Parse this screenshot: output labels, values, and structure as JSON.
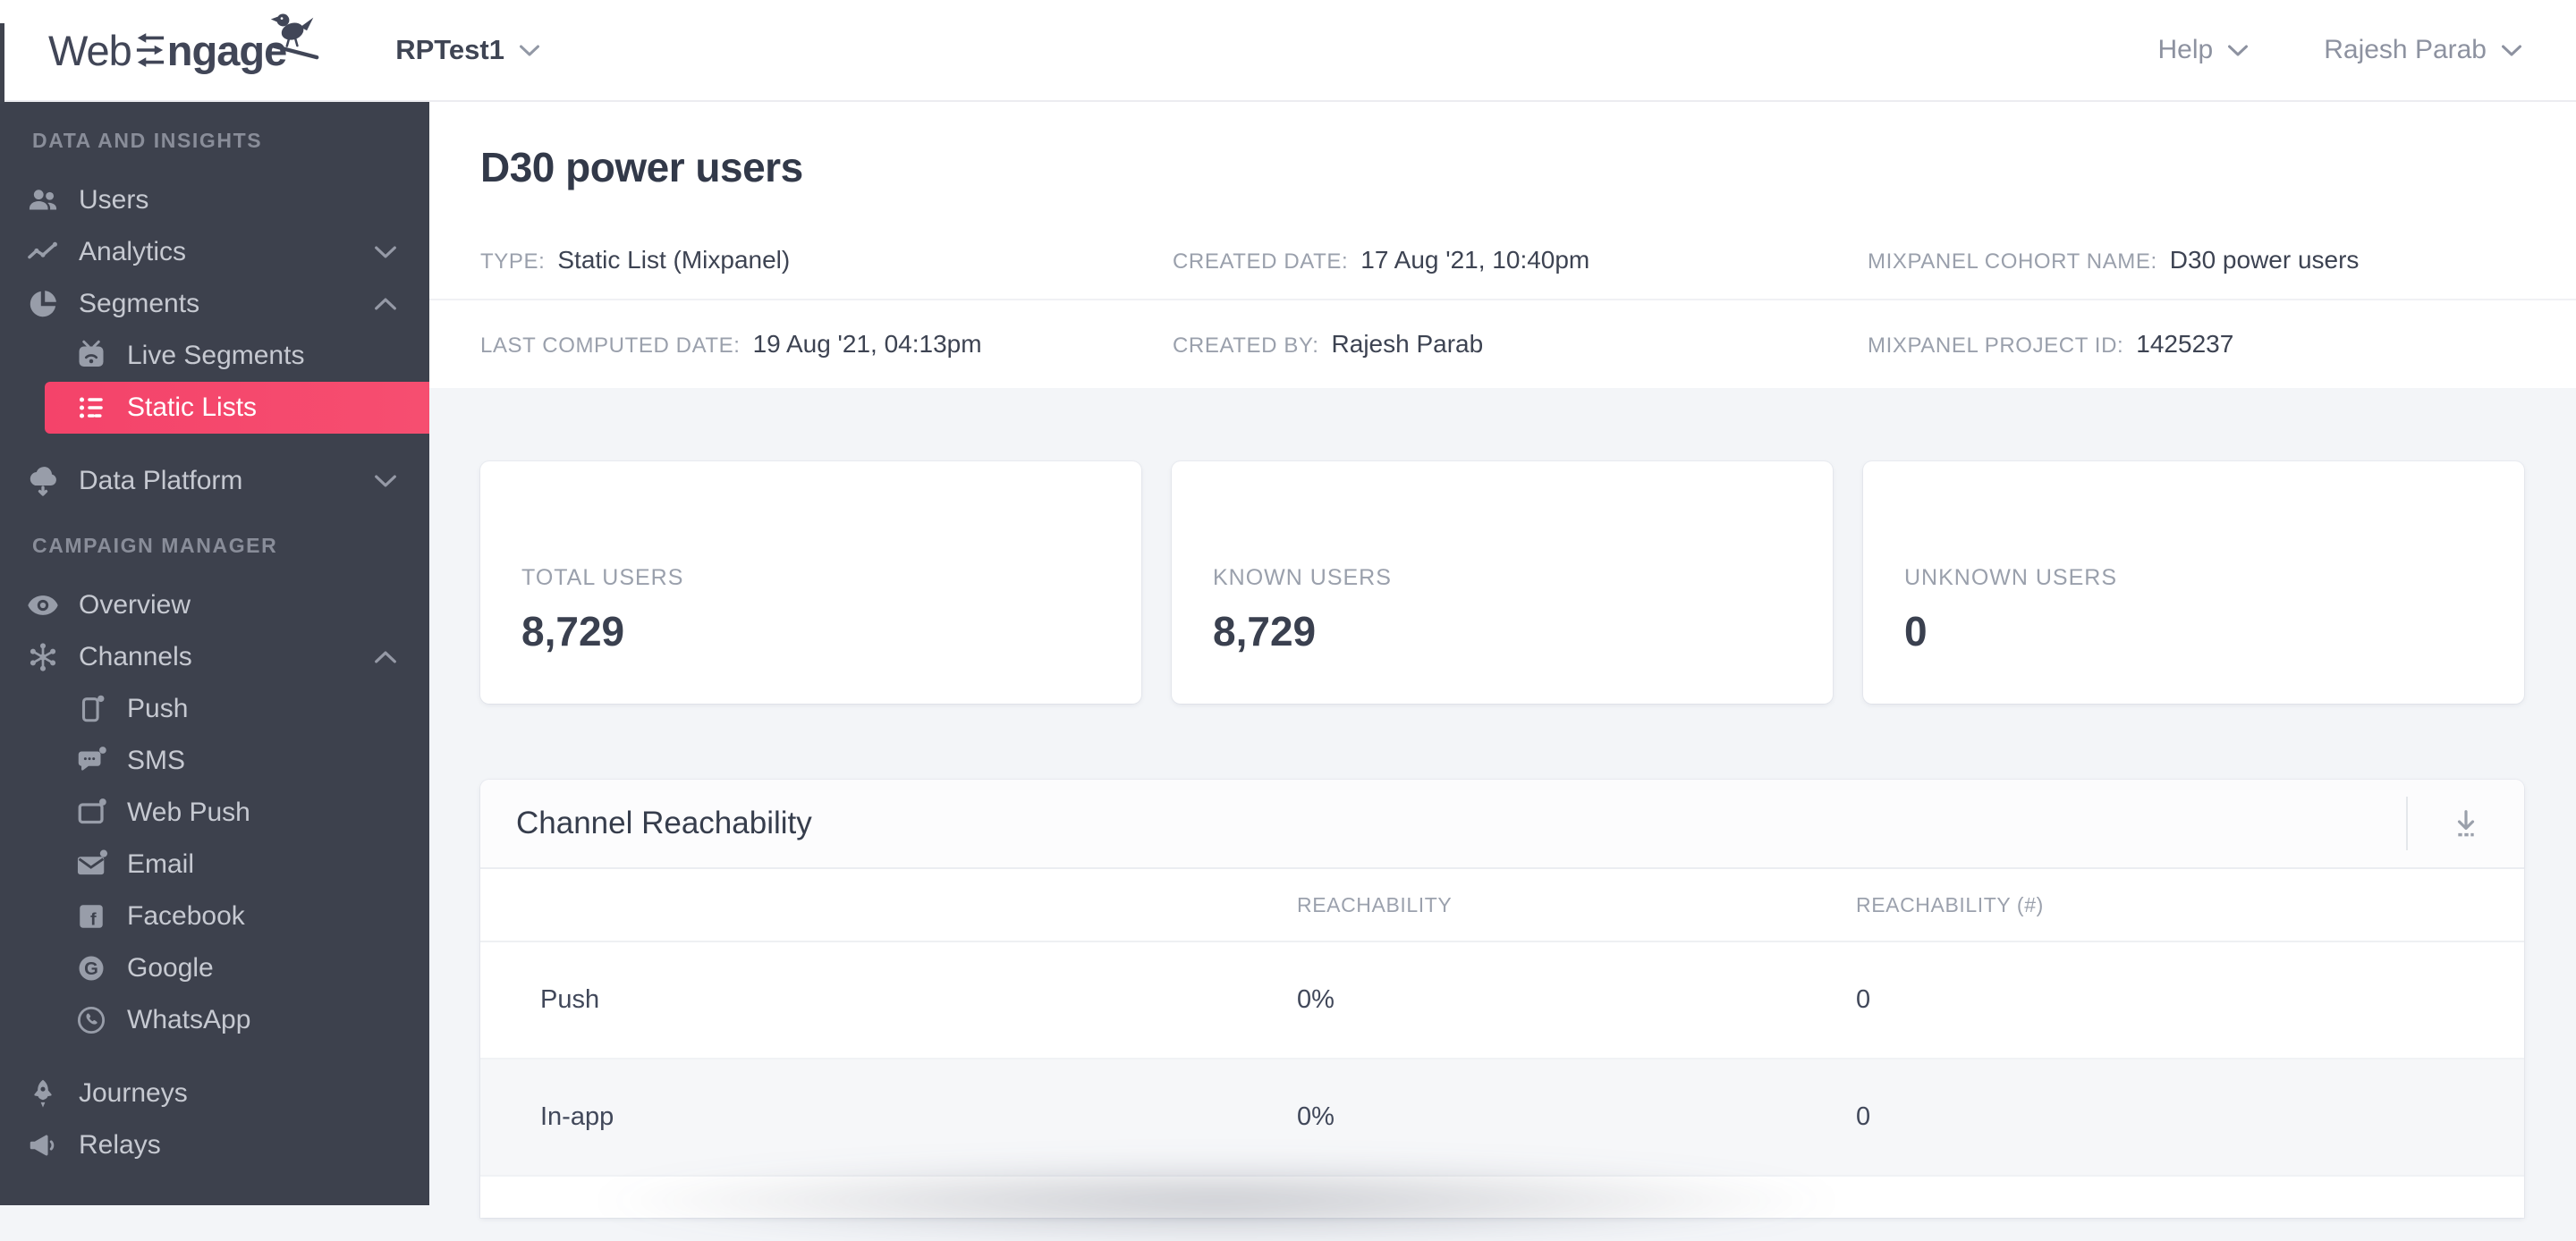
{
  "brand": {
    "logo_web": "Web",
    "logo_ngage": "ngage"
  },
  "topbar": {
    "project": "RPTest1",
    "help": "Help",
    "user": "Rajesh Parab"
  },
  "sidebar": {
    "section1_header": "DATA AND INSIGHTS",
    "users": "Users",
    "analytics": "Analytics",
    "segments": "Segments",
    "live_segments": "Live Segments",
    "static_lists": "Static Lists",
    "data_platform": "Data Platform",
    "section2_header": "CAMPAIGN MANAGER",
    "overview": "Overview",
    "channels": "Channels",
    "push": "Push",
    "sms": "SMS",
    "web_push": "Web Push",
    "email": "Email",
    "facebook": "Facebook",
    "google": "Google",
    "whatsapp": "WhatsApp",
    "journeys": "Journeys",
    "relays": "Relays"
  },
  "page": {
    "title": "D30 power users",
    "meta": {
      "type_label": "TYPE:",
      "type_value": "Static List (Mixpanel)",
      "created_date_label": "CREATED DATE:",
      "created_date_value": "17 Aug '21, 10:40pm",
      "cohort_label": "MIXPANEL COHORT NAME:",
      "cohort_value": "D30 power users",
      "last_computed_label": "LAST COMPUTED DATE:",
      "last_computed_value": "19 Aug '21, 04:13pm",
      "created_by_label": "CREATED BY:",
      "created_by_value": "Rajesh Parab",
      "project_id_label": "MIXPANEL PROJECT ID:",
      "project_id_value": "1425237"
    }
  },
  "stats": {
    "total": {
      "label": "TOTAL USERS",
      "value": "8,729"
    },
    "known": {
      "label": "KNOWN USERS",
      "value": "8,729"
    },
    "unknown": {
      "label": "UNKNOWN USERS",
      "value": "0"
    }
  },
  "reachability": {
    "title": "Channel Reachability",
    "col_reachability": "REACHABILITY",
    "col_reachability_count": "REACHABILITY (#)",
    "rows": [
      {
        "channel": "Push",
        "reachability": "0%",
        "count": "0"
      },
      {
        "channel": "In-app",
        "reachability": "0%",
        "count": "0"
      }
    ]
  },
  "colors": {
    "accent": "#f4476c",
    "sidebar_bg": "#3d414d",
    "text_dark": "#3d4352"
  }
}
